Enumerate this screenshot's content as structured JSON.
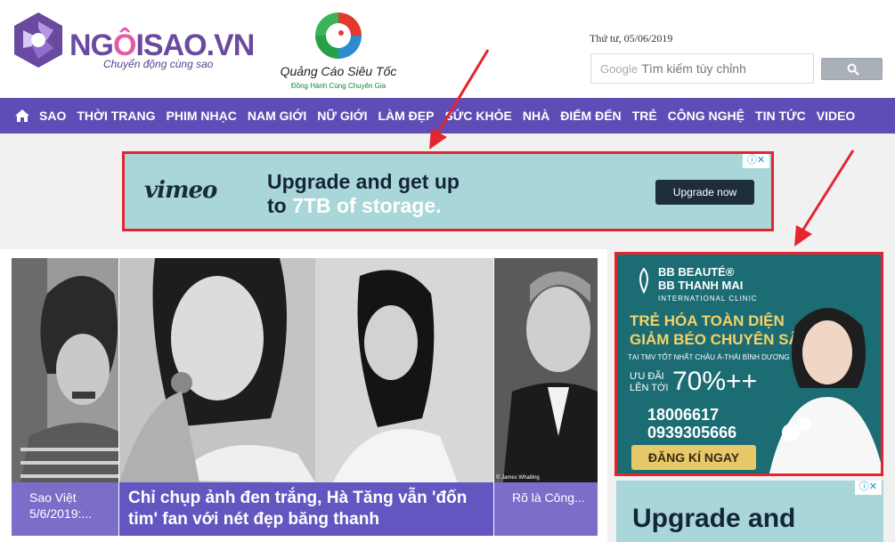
{
  "header": {
    "site_name_a": "NG",
    "site_name_o": "Ô",
    "site_name_b": "ISAO.VN",
    "tagline": "Chuyển động cùng sao",
    "ad_logo_title": "Quảng Cáo Siêu Tốc",
    "ad_logo_sub": "Đồng Hành Cùng Chuyên Gia",
    "date": "Thứ tư, 05/06/2019",
    "search": {
      "google": "Google",
      "placeholder": "Tìm kiếm tùy chỉnh"
    }
  },
  "nav": {
    "items": [
      "SAO",
      "THỜI TRANG",
      "PHIM NHẠC",
      "NAM GIỚI",
      "NỮ GIỚI",
      "LÀM ĐẸP",
      "SỨC KHỎE",
      "NHÀ",
      "ĐIỂM ĐẾN",
      "TRẺ",
      "CÔNG NGHỆ",
      "TIN TỨC",
      "VIDEO"
    ]
  },
  "banner": {
    "brand": "vimeo",
    "headline_1": "Upgrade and get up",
    "headline_2a": "to ",
    "headline_2b": "7TB of storage.",
    "button": "Upgrade now",
    "adchoices": "ⓘ✕"
  },
  "articles": [
    {
      "caption": "Sao Việt 5/6/2019:..."
    },
    {
      "caption": "Chỉ chụp ảnh đen trắng, Hà Tăng vẫn 'đốn tim' fan với nét đẹp băng thanh"
    },
    {
      "caption": "Rõ là Công..."
    }
  ],
  "photo_credit": "© James Whatling",
  "right_ad": {
    "brand_1": "BB BEAUTÉ®",
    "brand_2": "BB THANH MAI",
    "brand_3": "INTERNATIONAL CLINIC",
    "head_1": "TRẺ HÓA TOÀN DIỆN",
    "head_2": "GIẢM BÉO CHUYÊN SÂU",
    "sub": "TẠI TMV TỐT NHẤT CHÂU Á-THÁI BÌNH DƯƠNG",
    "offer_label_1": "ƯU ĐÃI",
    "offer_label_2": "LÊN TỚI",
    "offer": "70%++",
    "phone_1": "18006617",
    "phone_2": "0939305666",
    "button": "ĐĂNG KÍ NGAY"
  },
  "right_ad2": {
    "headline": "Upgrade and",
    "adchoices": "ⓘ✕"
  },
  "colors": {
    "nav": "#5f4cb6",
    "caption": "#7b6ec8",
    "highlight": "#e4252d",
    "vimeo_bg": "#a9d6d8"
  }
}
